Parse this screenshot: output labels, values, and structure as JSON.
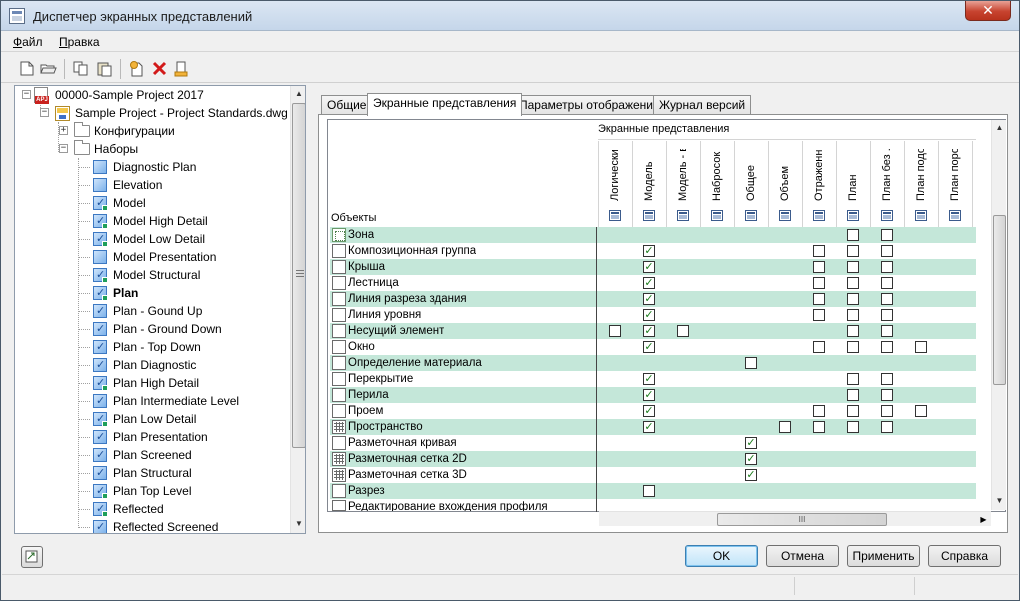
{
  "window": {
    "title": "Диспетчер экранных представлений",
    "close_label": "✕"
  },
  "menu": [
    {
      "hotkey": "Ф",
      "rest": "айл"
    },
    {
      "hotkey": "П",
      "rest": "равка"
    }
  ],
  "toolbar": [
    {
      "name": "new-icon",
      "glyph": "🗋"
    },
    {
      "name": "open-icon",
      "glyph": "📂"
    },
    {
      "name": "copy-icon",
      "glyph": "⧉"
    },
    {
      "name": "paste-icon",
      "glyph": "📋"
    },
    {
      "name": "new-item-icon",
      "glyph": "✦"
    },
    {
      "name": "delete-icon",
      "glyph": "✖"
    },
    {
      "name": "purge-icon",
      "glyph": "⚱"
    }
  ],
  "tree": {
    "project": "00000-Sample Project 2017",
    "drawing": "Sample Project - Project Standards.dwg",
    "configurations": "Конфигурации",
    "sets_label": "Наборы",
    "sets": [
      {
        "label": "Diagnostic Plan",
        "check": false,
        "green": false,
        "bold": false
      },
      {
        "label": "Elevation",
        "check": false,
        "green": false,
        "bold": false
      },
      {
        "label": "Model",
        "check": true,
        "green": true,
        "bold": false
      },
      {
        "label": "Model High Detail",
        "check": true,
        "green": true,
        "bold": false
      },
      {
        "label": "Model Low Detail",
        "check": true,
        "green": true,
        "bold": false
      },
      {
        "label": "Model Presentation",
        "check": false,
        "green": false,
        "bold": false
      },
      {
        "label": "Model Structural",
        "check": true,
        "green": true,
        "bold": false
      },
      {
        "label": "Plan",
        "check": true,
        "green": true,
        "bold": true
      },
      {
        "label": "Plan - Gound Up",
        "check": true,
        "green": false,
        "bold": false
      },
      {
        "label": "Plan - Ground Down",
        "check": true,
        "green": false,
        "bold": false
      },
      {
        "label": "Plan - Top Down",
        "check": true,
        "green": false,
        "bold": false
      },
      {
        "label": "Plan Diagnostic",
        "check": true,
        "green": false,
        "bold": false
      },
      {
        "label": "Plan High Detail",
        "check": true,
        "green": true,
        "bold": false
      },
      {
        "label": "Plan Intermediate Level",
        "check": true,
        "green": false,
        "bold": false
      },
      {
        "label": "Plan Low Detail",
        "check": true,
        "green": true,
        "bold": false
      },
      {
        "label": "Plan Presentation",
        "check": true,
        "green": false,
        "bold": false
      },
      {
        "label": "Plan Screened",
        "check": true,
        "green": false,
        "bold": false
      },
      {
        "label": "Plan Structural",
        "check": true,
        "green": false,
        "bold": false
      },
      {
        "label": "Plan Top Level",
        "check": true,
        "green": true,
        "bold": false
      },
      {
        "label": "Reflected",
        "check": true,
        "green": true,
        "bold": false
      },
      {
        "label": "Reflected Screened",
        "check": true,
        "green": false,
        "bold": false
      }
    ]
  },
  "tabs": [
    "Общие",
    "Экранные представления",
    "Параметры отображения",
    "Журнал версий"
  ],
  "active_tab": 1,
  "grid": {
    "group_header": "Экранные представления",
    "objects_header": "Объекты",
    "columns": [
      "Логический",
      "Модель",
      "Модель - в...",
      "Набросок",
      "Общее",
      "Объем",
      "Отраженн...",
      "План",
      "План без ...",
      "План подо...",
      "План поро...",
      "П..."
    ],
    "rows": [
      {
        "name": "Зона",
        "icon": "zone",
        "cells": [
          null,
          null,
          null,
          null,
          null,
          null,
          null,
          false,
          false,
          null,
          null
        ]
      },
      {
        "name": "Композиционная группа",
        "icon": "default",
        "cells": [
          null,
          true,
          null,
          null,
          null,
          null,
          false,
          false,
          false,
          null,
          null
        ]
      },
      {
        "name": "Крыша",
        "icon": "default",
        "cells": [
          null,
          true,
          null,
          null,
          null,
          null,
          false,
          false,
          false,
          null,
          null
        ]
      },
      {
        "name": "Лестница",
        "icon": "default",
        "cells": [
          null,
          true,
          null,
          null,
          null,
          null,
          false,
          false,
          false,
          null,
          null
        ]
      },
      {
        "name": "Линия разреза здания",
        "icon": "default",
        "cells": [
          null,
          true,
          null,
          null,
          null,
          null,
          false,
          false,
          false,
          null,
          null
        ]
      },
      {
        "name": "Линия уровня",
        "icon": "default",
        "cells": [
          null,
          true,
          null,
          null,
          null,
          null,
          false,
          false,
          false,
          null,
          null
        ]
      },
      {
        "name": "Несущий элемент",
        "icon": "default",
        "cells": [
          false,
          true,
          false,
          null,
          null,
          null,
          null,
          false,
          false,
          null,
          null
        ]
      },
      {
        "name": "Окно",
        "icon": "default",
        "cells": [
          null,
          true,
          null,
          null,
          null,
          null,
          false,
          false,
          false,
          false,
          null
        ]
      },
      {
        "name": "Определение материала",
        "icon": "default",
        "cells": [
          null,
          null,
          null,
          null,
          false,
          null,
          null,
          null,
          null,
          null,
          null
        ]
      },
      {
        "name": "Перекрытие",
        "icon": "default",
        "cells": [
          null,
          true,
          null,
          null,
          null,
          null,
          null,
          false,
          false,
          null,
          null
        ]
      },
      {
        "name": "Перила",
        "icon": "default",
        "cells": [
          null,
          true,
          null,
          null,
          null,
          null,
          null,
          false,
          false,
          null,
          null
        ]
      },
      {
        "name": "Проем",
        "icon": "default",
        "cells": [
          null,
          true,
          null,
          null,
          null,
          null,
          false,
          false,
          false,
          false,
          null
        ]
      },
      {
        "name": "Пространство",
        "icon": "grid",
        "cells": [
          null,
          true,
          null,
          null,
          null,
          false,
          false,
          false,
          false,
          null,
          null
        ]
      },
      {
        "name": "Разметочная кривая",
        "icon": "default",
        "cells": [
          null,
          null,
          null,
          null,
          true,
          null,
          null,
          null,
          null,
          null,
          null
        ]
      },
      {
        "name": "Разметочная сетка 2D",
        "icon": "grid",
        "cells": [
          null,
          null,
          null,
          null,
          true,
          null,
          null,
          null,
          null,
          null,
          null
        ]
      },
      {
        "name": "Разметочная сетка 3D",
        "icon": "grid",
        "cells": [
          null,
          null,
          null,
          null,
          true,
          null,
          null,
          null,
          null,
          null,
          null
        ]
      },
      {
        "name": "Разрез",
        "icon": "default",
        "cells": [
          null,
          false,
          null,
          null,
          null,
          null,
          null,
          null,
          null,
          null,
          null
        ]
      },
      {
        "name": "Редактирование вхождения профиля",
        "icon": "default",
        "cells": [
          null,
          null,
          null,
          null,
          true,
          null,
          null,
          null,
          null,
          null,
          null
        ]
      }
    ],
    "hscroll_grip": "III"
  },
  "buttons": {
    "ok": "OK",
    "cancel": "Отмена",
    "apply": "Применить",
    "help": "Справка"
  },
  "colors": {
    "row_alt": "#c4e7d9",
    "check": "#1a7a1a",
    "accent": "#3c78c2",
    "close": "#c7432f"
  }
}
